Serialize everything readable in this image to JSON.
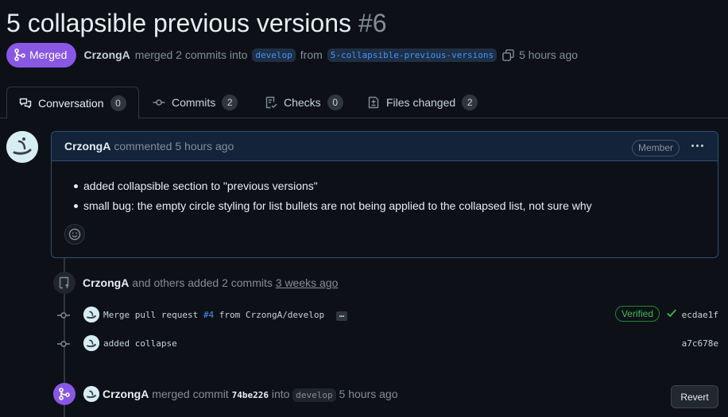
{
  "pr": {
    "title": "5 collapsible previous versions",
    "number": "#6",
    "state": "Merged",
    "author": "CrzongA",
    "merged_text": "merged 2 commits into",
    "base_branch": "develop",
    "from_text": "from",
    "head_branch": "5-collapsible-previous-versions",
    "time": "5 hours ago"
  },
  "tabs": [
    {
      "label": "Conversation",
      "count": "0",
      "icon": "conversation-icon"
    },
    {
      "label": "Commits",
      "count": "2",
      "icon": "commit-icon"
    },
    {
      "label": "Checks",
      "count": "0",
      "icon": "checklist-icon"
    },
    {
      "label": "Files changed",
      "count": "2",
      "icon": "file-diff-icon"
    }
  ],
  "comment": {
    "author": "CrzongA",
    "action": "commented 5 hours ago",
    "role": "Member",
    "items": [
      "added collapsible section to \"previous versions\"",
      "small bug: the empty circle styling for list bullets are not being applied to the collapsed list, not sure why"
    ]
  },
  "commits_event": {
    "author": "CrzongA",
    "text": "and others added 2 commits",
    "time": "3 weeks ago",
    "commits": [
      {
        "msg_prefix": "Merge pull request",
        "pr_link": "#4",
        "msg_suffix": "from CrzongA/develop",
        "verified": "Verified",
        "sha": "ecdae1f"
      },
      {
        "msg": "added collapse",
        "sha": "a7c678e"
      }
    ]
  },
  "merge_event": {
    "author": "CrzongA",
    "text": "merged commit",
    "sha": "74be226",
    "into": "into",
    "branch": "develop",
    "time": "5 hours ago",
    "revert_label": "Revert"
  },
  "colors": {
    "merged": "#8957e5",
    "link": "#4493f8",
    "verified": "#3fb950",
    "background": "#0d1117"
  }
}
